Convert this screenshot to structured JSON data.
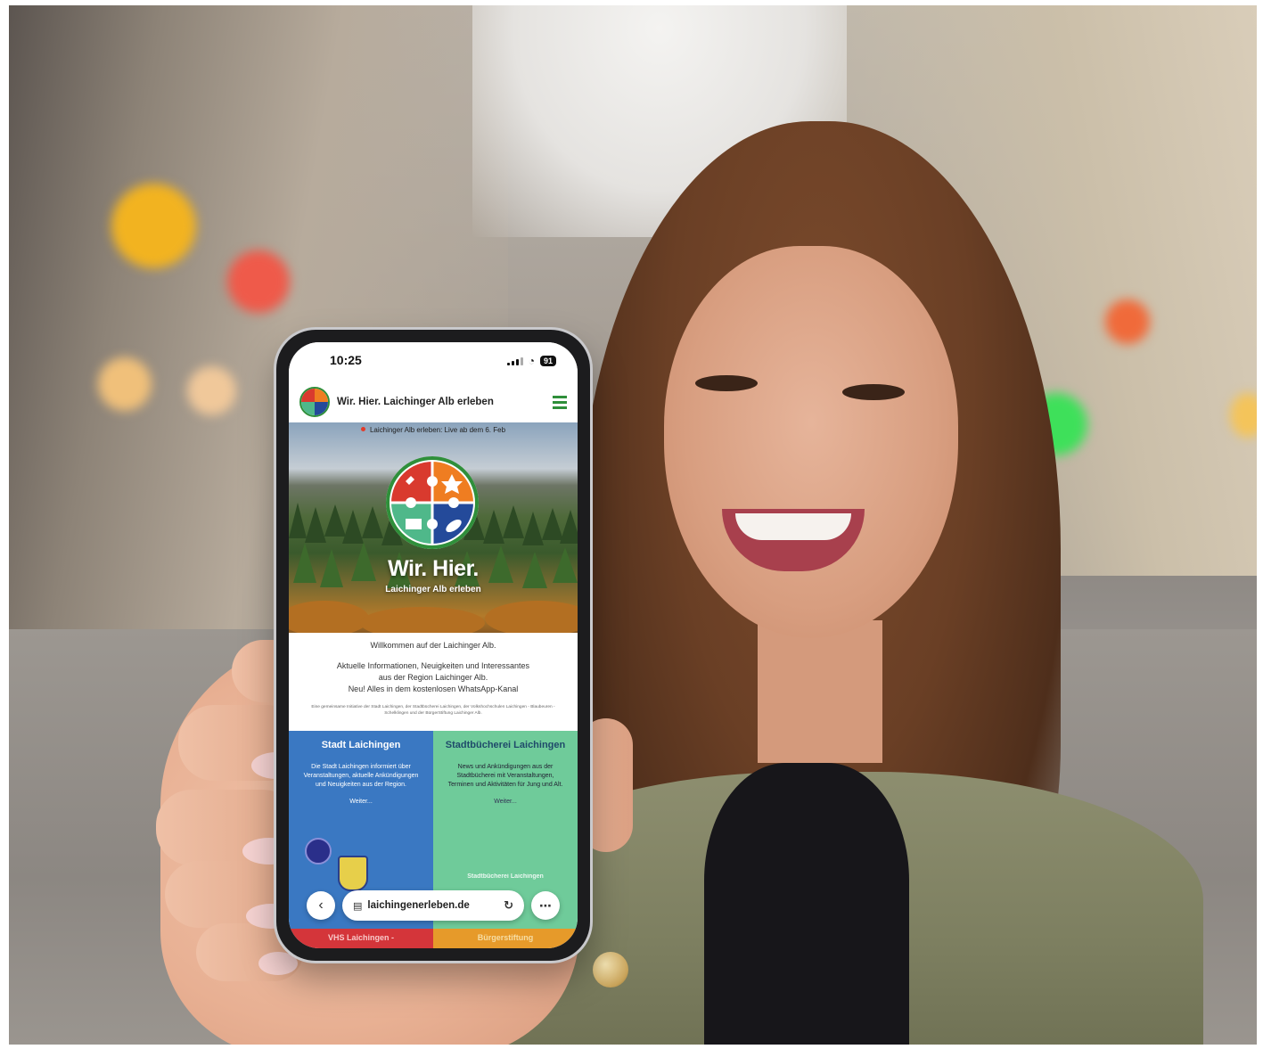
{
  "status_bar": {
    "time": "10:25",
    "battery": "91"
  },
  "site": {
    "title": "Wir. Hier. Laichinger Alb erleben",
    "ticker": "Laichinger Alb erleben: Live ab dem 6. Feb",
    "hero_title": "Wir. Hier.",
    "hero_subtitle": "Laichinger Alb erleben",
    "welcome": "Willkommen auf der Laichinger Alb.",
    "info_line1": "Aktuelle Informationen, Neuigkeiten und Interessantes",
    "info_line2": "aus der Region Laichinger Alb.",
    "info_line3": "Neu! Alles in dem kostenlosen WhatsApp-Kanal",
    "fine_print": "Eine gemeinsame Initiative der Stadt Laichingen, der Stadtbücherei Laichingen, der Volkshochschulen Laichingen - Blaubeuren - Schelklingen und der BürgerStiftung Laichinger Alb."
  },
  "tiles": [
    {
      "title": "Stadt Laichingen",
      "text": "Die Stadt Laichingen informiert über Veranstaltungen, aktuelle Ankündigungen und Neuigkeiten aus der Region.",
      "more": "Weiter..."
    },
    {
      "title": "Stadtbücherei Laichingen",
      "text": "News und Ankündigungen aus der Stadtbücherei mit Veranstaltungen, Terminen und Aktivitäten für Jung und Alt.",
      "more": "Weiter...",
      "mark": "Stadtbücherei Laichingen"
    }
  ],
  "bottom_strip": {
    "left": "VHS Laichingen -",
    "right": "Bürgerstiftung"
  },
  "browser": {
    "url": "laichingenerleben.de",
    "back_icon": "chevron-left-icon",
    "more_icon": "ellipsis-icon",
    "reload_icon": "reload-icon"
  },
  "colors": {
    "brand_green": "#2f8f3a",
    "tile_blue": "#3a78c2",
    "tile_green": "#6fcb9a",
    "strip_red": "#d4353a",
    "strip_orange": "#e69a2a"
  }
}
